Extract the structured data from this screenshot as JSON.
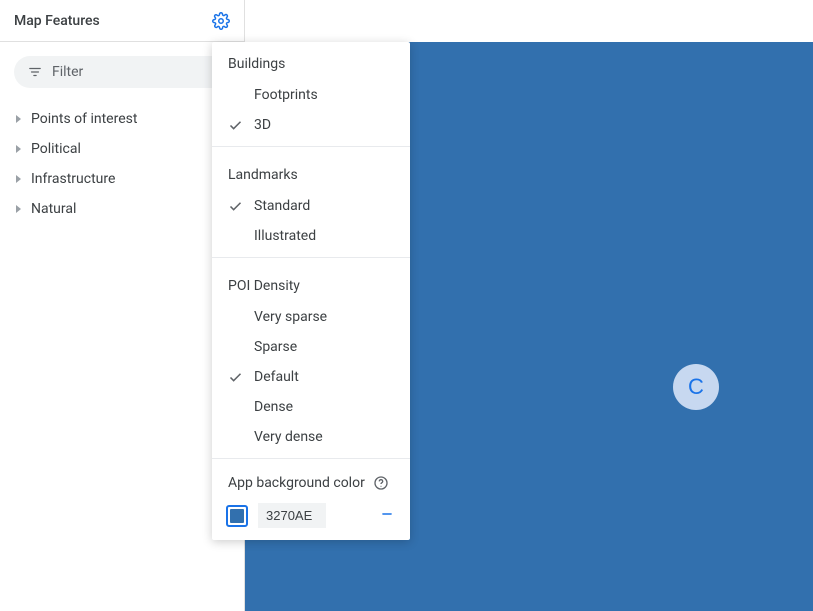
{
  "sidebar": {
    "title": "Map Features",
    "filter_placeholder": "Filter",
    "items": [
      {
        "label": "Points of interest"
      },
      {
        "label": "Political"
      },
      {
        "label": "Infrastructure"
      },
      {
        "label": "Natural"
      }
    ]
  },
  "settings": {
    "buildings": {
      "header": "Buildings",
      "options": [
        {
          "label": "Footprints",
          "checked": false
        },
        {
          "label": "3D",
          "checked": true
        }
      ]
    },
    "landmarks": {
      "header": "Landmarks",
      "options": [
        {
          "label": "Standard",
          "checked": true
        },
        {
          "label": "Illustrated",
          "checked": false
        }
      ]
    },
    "poi_density": {
      "header": "POI Density",
      "options": [
        {
          "label": "Very sparse",
          "checked": false
        },
        {
          "label": "Sparse",
          "checked": false
        },
        {
          "label": "Default",
          "checked": true
        },
        {
          "label": "Dense",
          "checked": false
        },
        {
          "label": "Very dense",
          "checked": false
        }
      ]
    },
    "app_bg": {
      "label": "App background color",
      "hex": "3270AE",
      "color": "#3270AE"
    }
  },
  "canvas": {
    "background": "#3270AE",
    "top_gap_background": "#ffffff"
  },
  "avatar": {
    "letter": "C"
  }
}
